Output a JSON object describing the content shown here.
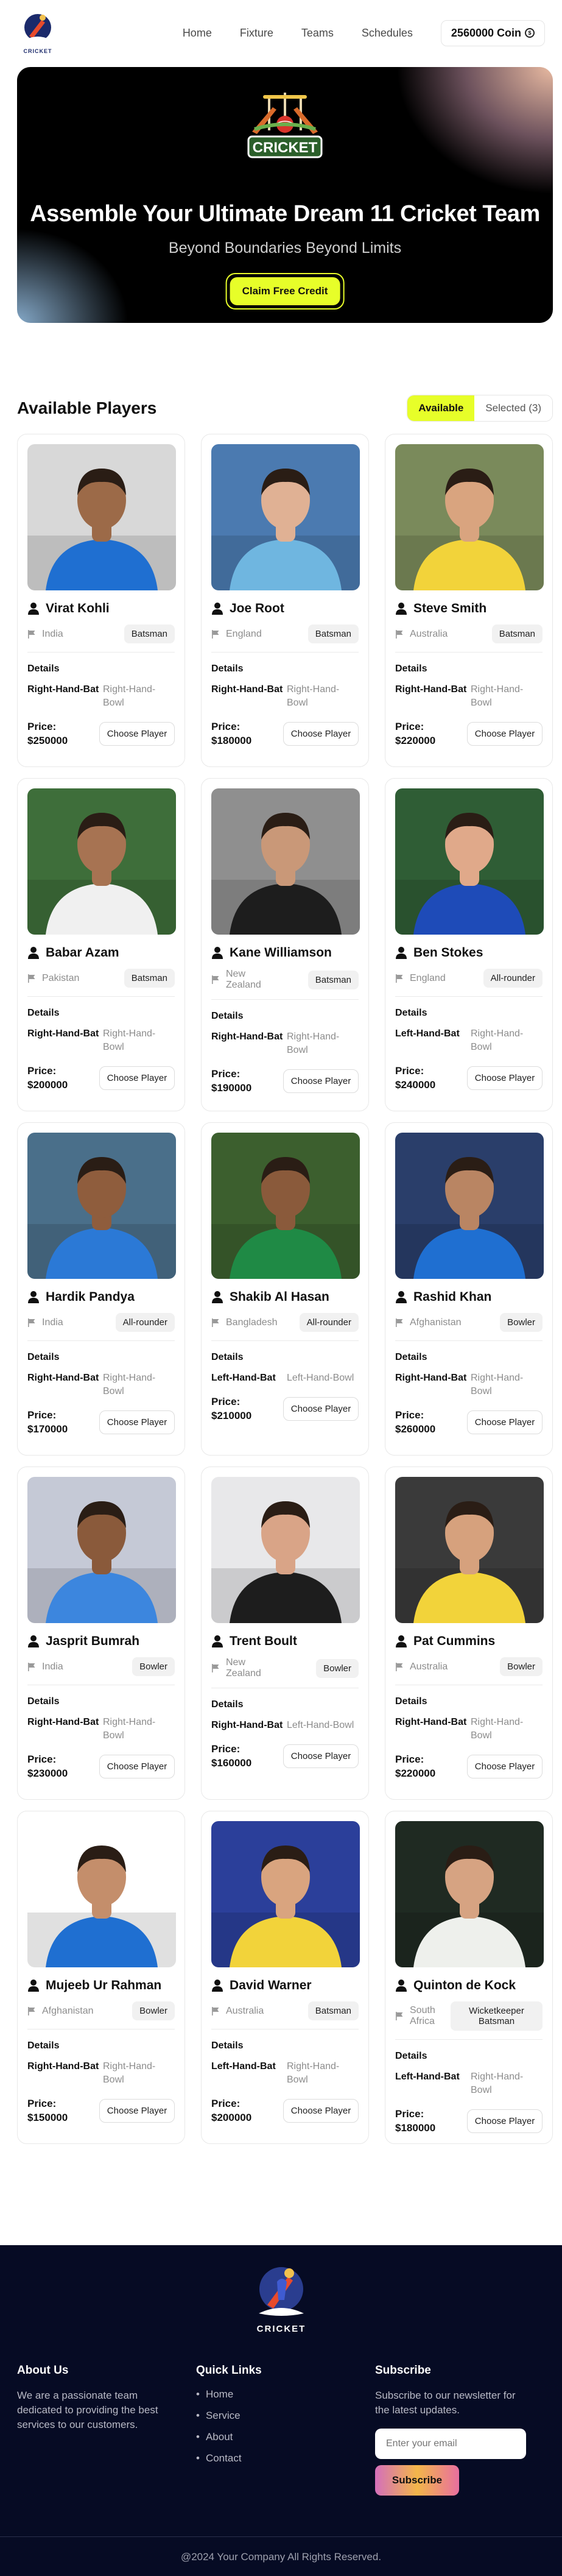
{
  "nav": {
    "links": [
      "Home",
      "Fixture",
      "Teams",
      "Schedules"
    ],
    "coin": "2560000 Coin"
  },
  "hero": {
    "logo_text": "CRICKET",
    "title": "Assemble Your Ultimate Dream 11 Cricket Team",
    "subtitle": "Beyond Boundaries Beyond Limits",
    "button": "Claim Free Credit"
  },
  "players_section": {
    "title": "Available Players",
    "tab_available": "Available",
    "tab_selected": "Selected (3)",
    "details_label": "Details",
    "choose_label": "Choose Player"
  },
  "players": [
    {
      "name": "Virat Kohli",
      "country": "India",
      "role": "Batsman",
      "bat": "Right-Hand-Bat",
      "bowl": "Right-Hand-Bowl",
      "price": "Price: $250000",
      "jersey": "#1f6fd1",
      "skin": "#9c6a48",
      "bg": "#d8d8d8"
    },
    {
      "name": "Joe Root",
      "country": "England",
      "role": "Batsman",
      "bat": "Right-Hand-Bat",
      "bowl": "Right-Hand-Bowl",
      "price": "Price: $180000",
      "jersey": "#6fb6e0",
      "skin": "#e0b194",
      "bg": "#4b7ab0"
    },
    {
      "name": "Steve Smith",
      "country": "Australia",
      "role": "Batsman",
      "bat": "Right-Hand-Bat",
      "bowl": "Right-Hand-Bowl",
      "price": "Price: $220000",
      "jersey": "#f2d33a",
      "skin": "#d9a47f",
      "bg": "#7a8a5b"
    },
    {
      "name": "Babar Azam",
      "country": "Pakistan",
      "role": "Batsman",
      "bat": "Right-Hand-Bat",
      "bowl": "Right-Hand-Bowl",
      "price": "Price: $200000",
      "jersey": "#f0f0f0",
      "skin": "#a77352",
      "bg": "#3e6e3a"
    },
    {
      "name": "Kane Williamson",
      "country": "New Zealand",
      "role": "Batsman",
      "bat": "Right-Hand-Bat",
      "bowl": "Right-Hand-Bowl",
      "price": "Price: $190000",
      "jersey": "#1d1d1d",
      "skin": "#c99878",
      "bg": "#8f8f8f"
    },
    {
      "name": "Ben Stokes",
      "country": "England",
      "role": "All-rounder",
      "bat": "Left-Hand-Bat",
      "bowl": "Right-Hand-Bowl",
      "price": "Price: $240000",
      "jersey": "#1e4bb8",
      "skin": "#e0a98a",
      "bg": "#2f5d35"
    },
    {
      "name": "Hardik Pandya",
      "country": "India",
      "role": "All-rounder",
      "bat": "Right-Hand-Bat",
      "bowl": "Right-Hand-Bowl",
      "price": "Price: $170000",
      "jersey": "#2b79d6",
      "skin": "#8f5d3d",
      "bg": "#4a6f8a"
    },
    {
      "name": "Shakib Al Hasan",
      "country": "Bangladesh",
      "role": "All-rounder",
      "bat": "Left-Hand-Bat",
      "bowl": "Left-Hand-Bowl",
      "price": "Price: $210000",
      "jersey": "#1f8a45",
      "skin": "#8a5a3b",
      "bg": "#3c5f2e"
    },
    {
      "name": "Rashid Khan",
      "country": "Afghanistan",
      "role": "Bowler",
      "bat": "Right-Hand-Bat",
      "bowl": "Right-Hand-Bowl",
      "price": "Price: $260000",
      "jersey": "#1f6fd1",
      "skin": "#b98563",
      "bg": "#2a3e6a"
    },
    {
      "name": "Jasprit Bumrah",
      "country": "India",
      "role": "Bowler",
      "bat": "Right-Hand-Bat",
      "bowl": "Right-Hand-Bowl",
      "price": "Price: $230000",
      "jersey": "#3c86de",
      "skin": "#8a5a3b",
      "bg": "#c5c9d6"
    },
    {
      "name": "Trent Boult",
      "country": "New Zealand",
      "role": "Bowler",
      "bat": "Right-Hand-Bat",
      "bowl": "Left-Hand-Bowl",
      "price": "Price: $160000",
      "jersey": "#1d1d1d",
      "skin": "#d9a487",
      "bg": "#e8e8ea"
    },
    {
      "name": "Pat Cummins",
      "country": "Australia",
      "role": "Bowler",
      "bat": "Right-Hand-Bat",
      "bowl": "Right-Hand-Bowl",
      "price": "Price: $220000",
      "jersey": "#f2d33a",
      "skin": "#d6a17d",
      "bg": "#3a3a3a"
    },
    {
      "name": "Mujeeb Ur Rahman",
      "country": "Afghanistan",
      "role": "Bowler",
      "bat": "Right-Hand-Bat",
      "bowl": "Right-Hand-Bowl",
      "price": "Price: $150000",
      "jersey": "#1f6fd1",
      "skin": "#c48e6b",
      "bg": "#ffffff"
    },
    {
      "name": "David Warner",
      "country": "Australia",
      "role": "Batsman",
      "bat": "Left-Hand-Bat",
      "bowl": "Right-Hand-Bowl",
      "price": "Price: $200000",
      "jersey": "#f2d33a",
      "skin": "#d9a47f",
      "bg": "#2b3f9a"
    },
    {
      "name": "Quinton de Kock",
      "country": "South Africa",
      "role": "Wicketkeeper Batsman",
      "bat": "Left-Hand-Bat",
      "bowl": "Right-Hand-Bowl",
      "price": "Price: $180000",
      "jersey": "#eef0ec",
      "skin": "#d6a382",
      "bg": "#1f2a22"
    }
  ],
  "footer": {
    "logo_text": "CRICKET",
    "about_title": "About Us",
    "about_text": "We are a passionate team dedicated to providing the best services to our customers.",
    "links_title": "Quick Links",
    "links": [
      "Home",
      "Service",
      "About",
      "Contact"
    ],
    "subscribe_title": "Subscribe",
    "subscribe_text": "Subscribe to our newsletter for the latest updates.",
    "email_placeholder": "Enter your email",
    "subscribe_button": "Subscribe",
    "copyright": "@2024 Your Company All Rights Reserved."
  }
}
